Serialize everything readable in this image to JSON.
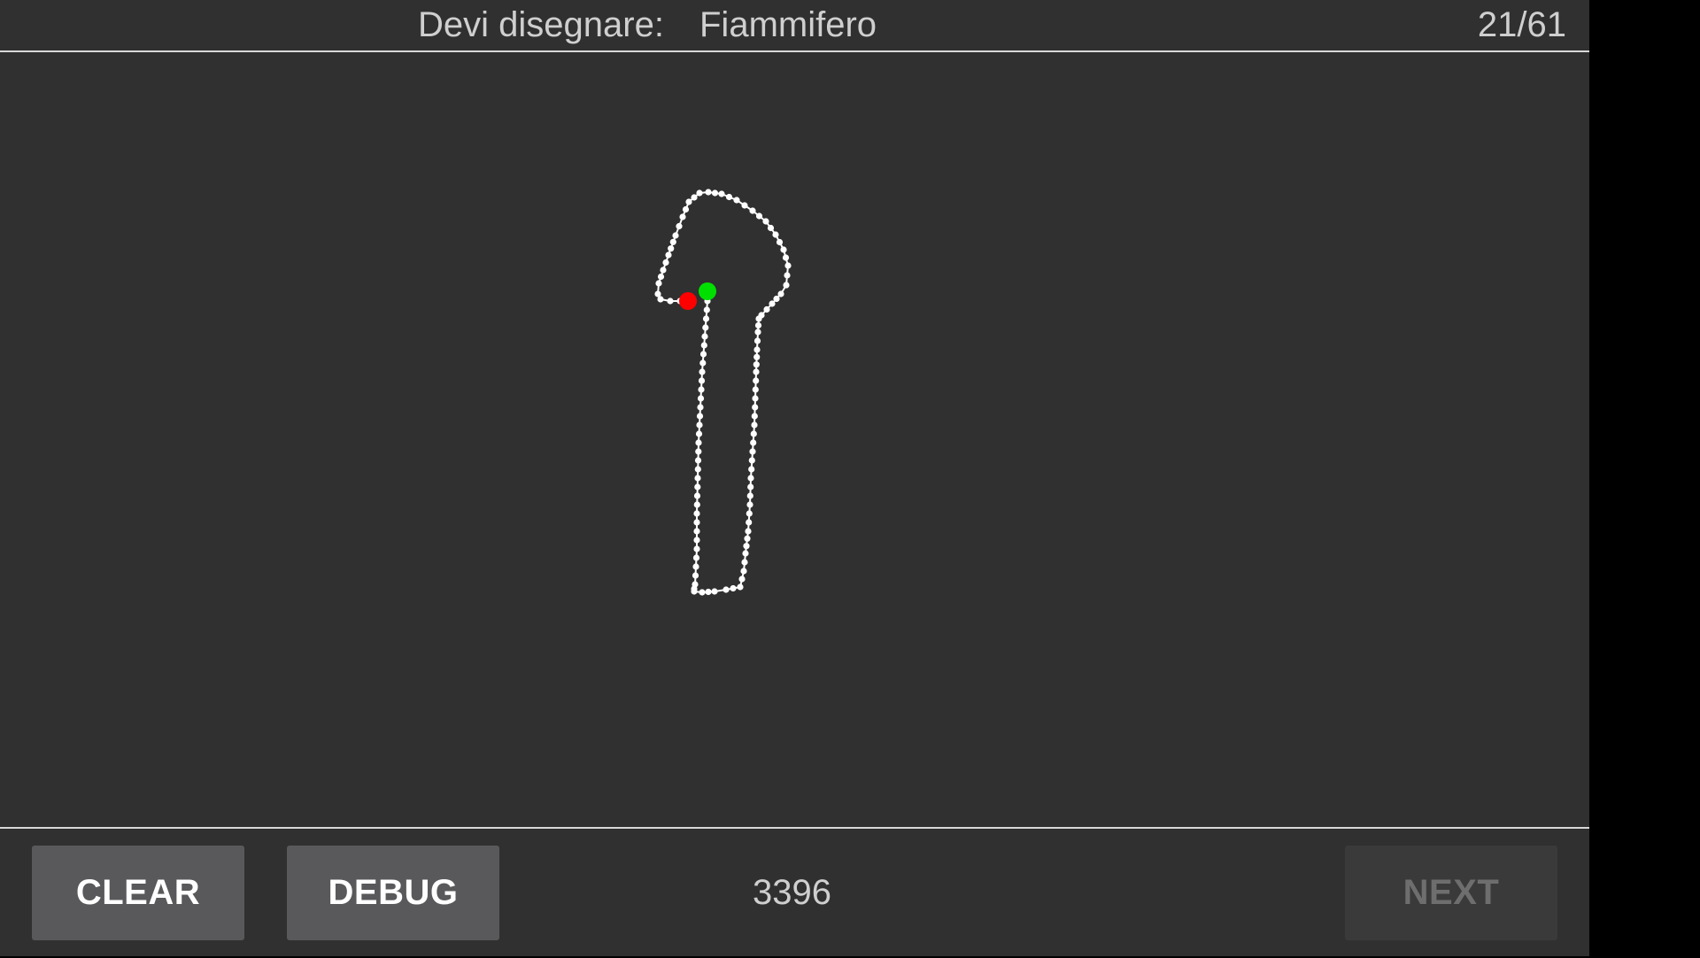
{
  "header": {
    "prompt_label": "Devi disegnare:",
    "target_word": "Fiammifero",
    "progress": "21/61"
  },
  "footer": {
    "clear_label": "CLEAR",
    "debug_label": "DEBUG",
    "score": "3396",
    "next_label": "NEXT",
    "next_enabled": false
  },
  "colors": {
    "background": "#303030",
    "stroke": "#ffffff",
    "start_dot": "#00e000",
    "end_dot": "#ff0000",
    "button": "#59595b",
    "button_disabled": "#3a3a3b"
  }
}
